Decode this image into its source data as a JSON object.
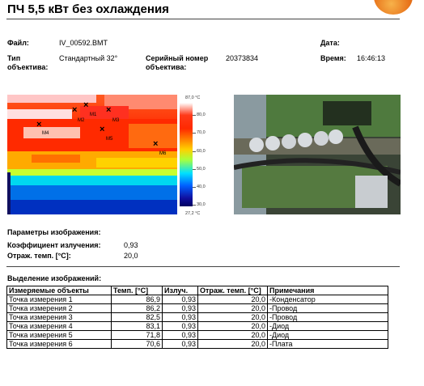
{
  "title": "ПЧ 5,5 кВт без охлаждения",
  "header": {
    "file_label": "Файл:",
    "file_value": "IV_00592.BMT",
    "date_label": "Дата:",
    "date_value": "",
    "type_label_1": "Тип",
    "type_label_2": "объектива:",
    "type_value": "Стандартный  32°",
    "serial_label_1": "Серийный номер",
    "serial_label_2": "объектива:",
    "serial_value": "20373834",
    "time_label": "Время:",
    "time_value": "16:46:13"
  },
  "thermogram": {
    "scale_max": "87,0 °C",
    "scale_min": "27,2 °C",
    "ticks": [
      "80,0",
      "70,0",
      "60,0",
      "50,0",
      "40,0",
      "30,0"
    ],
    "markers": [
      "M1",
      "M2",
      "M3",
      "M4",
      "M5",
      "M6"
    ]
  },
  "params": {
    "heading": "Параметры изображения:",
    "emissivity_label": "Коэффициент  излучения:",
    "emissivity_value": "0,93",
    "refl_label": "Отраж. темп. [°C]:",
    "refl_value": "20,0"
  },
  "selection": {
    "heading": "Выделение изображений:",
    "columns": [
      "Измеряемые объекты",
      "Темп. [°C]",
      "Излуч.",
      "Отраж. темп. [°C]",
      "Примечания"
    ],
    "rows": [
      [
        "Точка измерения  1",
        "86,9",
        "0,93",
        "20,0",
        "-Конденсатор"
      ],
      [
        "Точка измерения  2",
        "86,2",
        "0,93",
        "20,0",
        "-Провод"
      ],
      [
        "Точка измерения  3",
        "82,5",
        "0,93",
        "20,0",
        "-Провод"
      ],
      [
        "Точка измерения  4",
        "83,1",
        "0,93",
        "20,0",
        "-Диод"
      ],
      [
        "Точка измерения  5",
        "71,8",
        "0,93",
        "20,0",
        "-Диод"
      ],
      [
        "Точка измерения  6",
        "70,6",
        "0,93",
        "20,0",
        "-Плата"
      ]
    ]
  }
}
